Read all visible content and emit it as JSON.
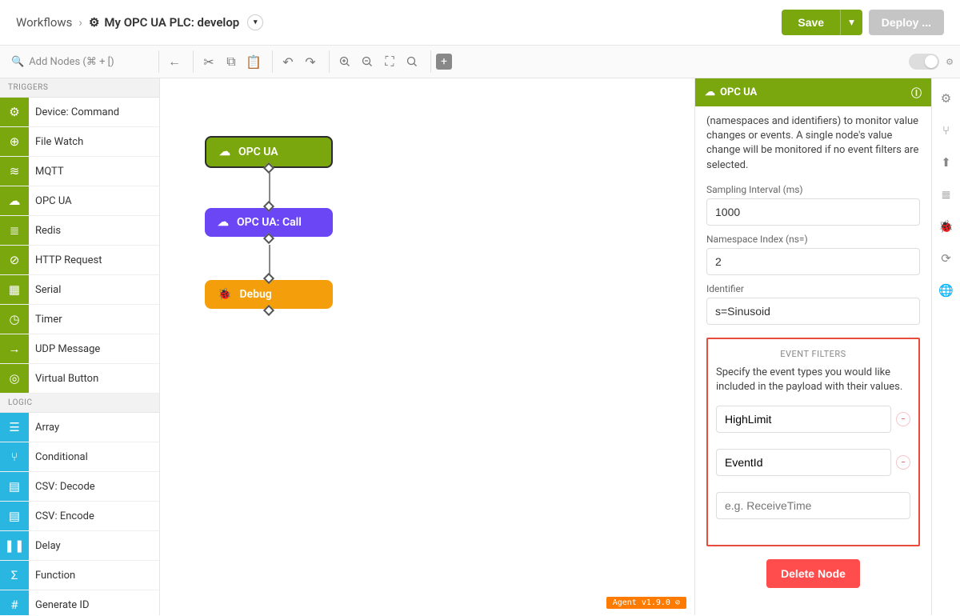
{
  "header": {
    "breadcrumb_root": "Workflows",
    "breadcrumb_title": "My OPC UA PLC: develop",
    "save_label": "Save",
    "deploy_label": "Deploy ..."
  },
  "toolbar": {
    "add_nodes_placeholder": "Add Nodes (⌘ + [)"
  },
  "sidebar": {
    "section_triggers": "TRIGGERS",
    "section_logic": "LOGIC",
    "triggers": [
      {
        "label": "Device: Command",
        "icon": "gear"
      },
      {
        "label": "File Watch",
        "icon": "file-plus"
      },
      {
        "label": "MQTT",
        "icon": "rss"
      },
      {
        "label": "OPC UA",
        "icon": "cloud"
      },
      {
        "label": "Redis",
        "icon": "layers"
      },
      {
        "label": "HTTP Request",
        "icon": "link"
      },
      {
        "label": "Serial",
        "icon": "serial"
      },
      {
        "label": "Timer",
        "icon": "clock"
      },
      {
        "label": "UDP Message",
        "icon": "arrow"
      },
      {
        "label": "Virtual Button",
        "icon": "target"
      }
    ],
    "logic": [
      {
        "label": "Array",
        "icon": "list"
      },
      {
        "label": "Conditional",
        "icon": "branch"
      },
      {
        "label": "CSV: Decode",
        "icon": "table"
      },
      {
        "label": "CSV: Encode",
        "icon": "table"
      },
      {
        "label": "Delay",
        "icon": "pause"
      },
      {
        "label": "Function",
        "icon": "sigma"
      },
      {
        "label": "Generate ID",
        "icon": "id"
      }
    ]
  },
  "canvas": {
    "nodes": [
      {
        "label": "OPC UA",
        "type": "opcua"
      },
      {
        "label": "OPC UA: Call",
        "type": "call"
      },
      {
        "label": "Debug",
        "type": "debug"
      }
    ],
    "agent_badge": "Agent v1.9.0 ⊘"
  },
  "panel": {
    "title": "OPC UA",
    "description": "(namespaces and identifiers) to monitor value changes or events. A single node's value change will be monitored if no event filters are selected.",
    "fields": {
      "sampling_label": "Sampling Interval (ms)",
      "sampling_value": "1000",
      "ns_label": "Namespace Index (ns=)",
      "ns_value": "2",
      "identifier_label": "Identifier",
      "identifier_value": "s=Sinusoid"
    },
    "event_filters": {
      "heading": "EVENT FILTERS",
      "description": "Specify the event types you would like included in the payload with their values.",
      "items": [
        "HighLimit",
        "EventId"
      ],
      "placeholder": "e.g. ReceiveTime"
    },
    "delete_label": "Delete Node"
  }
}
